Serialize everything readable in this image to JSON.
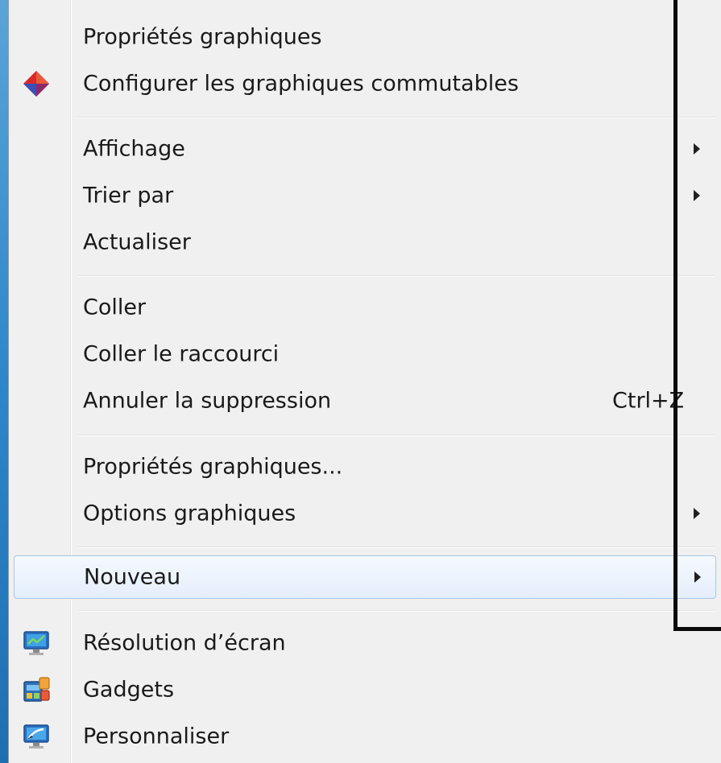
{
  "menu": {
    "items": [
      {
        "label": "Propriétés graphiques"
      },
      {
        "label": "Configurer les graphiques commutables",
        "icon": "amd-diamond-icon"
      },
      {
        "label": "Affichage",
        "submenu": true
      },
      {
        "label": "Trier par",
        "submenu": true
      },
      {
        "label": "Actualiser"
      },
      {
        "label": "Coller"
      },
      {
        "label": "Coller le raccourci"
      },
      {
        "label": "Annuler la suppression",
        "shortcut": "Ctrl+Z"
      },
      {
        "label": "Propriétés graphiques..."
      },
      {
        "label": "Options graphiques",
        "submenu": true
      },
      {
        "label": "Nouveau",
        "submenu": true,
        "highlighted": true
      },
      {
        "label": "Résolution d’écran",
        "icon": "monitor-resolution-icon"
      },
      {
        "label": "Gadgets",
        "icon": "gadgets-icon"
      },
      {
        "label": "Personnaliser",
        "icon": "personalize-monitor-icon"
      }
    ]
  },
  "colors": {
    "menu_bg": "#f0f0f0",
    "hover_border": "#a9c6ea",
    "annotation": "#0a0a0a",
    "desktop": "#2f86c8"
  }
}
